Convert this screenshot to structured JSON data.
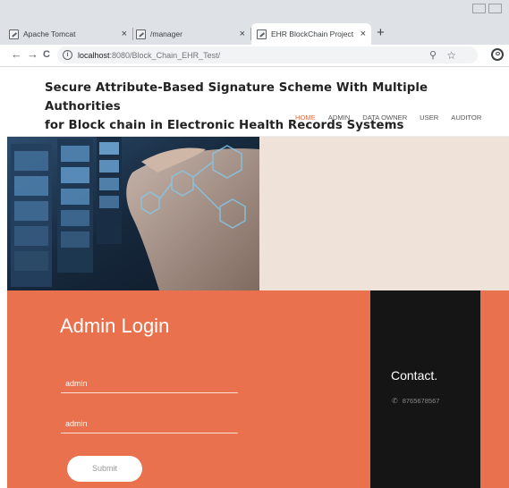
{
  "browser": {
    "tabs": [
      {
        "title": "Apache Tomcat"
      },
      {
        "title": "/manager"
      },
      {
        "title": "EHR BlockChain Project"
      }
    ],
    "new_tab_label": "+",
    "close_glyph": "×",
    "nav": {
      "back": "←",
      "forward": "→",
      "reload": "C"
    },
    "url_host": "localhost",
    "url_path": ":8080/Block_Chain_EHR_Test/"
  },
  "site": {
    "title_line1": "Secure Attribute-Based Signature Scheme With Multiple Authorities",
    "title_line2": "for Block chain in Electronic Health Records Systems",
    "menu": [
      "HOME",
      "ADMIN",
      "DATA OWNER",
      "USER",
      "AUDITOR"
    ],
    "accent_color": "#e8704a"
  },
  "login": {
    "title": "Admin Login",
    "username_value": "admin",
    "password_value": "admin",
    "submit_label": "Submit",
    "bg_color": "#e9714d"
  },
  "contact": {
    "title": "Contact.",
    "phone": "8765678567"
  }
}
